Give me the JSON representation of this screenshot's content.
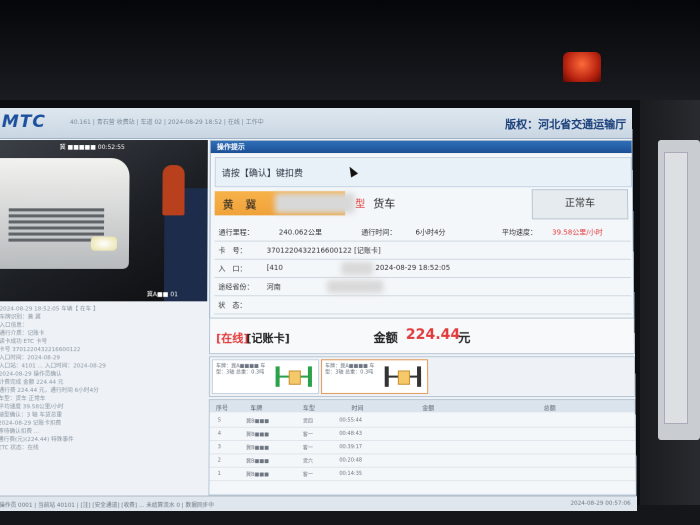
{
  "header": {
    "logo": "MTC",
    "org_name": "版权：河北省交通运输厅",
    "status_strip": "40.161  |  青石营 收费站  |  车道 02  |  2024-08-29 18:52  |  在线  |  工作中"
  },
  "camera": {
    "caption": "冀 ■■■■■  00:52:55",
    "stamp": "冀A■■ 01"
  },
  "log": [
    "2024-08-29 18:52:05 车辆【 在车 】",
    "车牌识别：黄 冀",
    "入口信息：",
    "通行介质：记账卡",
    "读卡成功 ETC 卡号",
    "卡号 3701220432216600122",
    "入口时间：2024-08-29",
    "入口站：4101 ... 入口时间：2024-08-29",
    "2024-08-29 操作员确认",
    "计费完成 金额 224.44 元",
    "通行费 224.44 元，通行时间 6小时4分",
    "车型：货车 正常车",
    "平均速度 39.58公里/小时",
    "轴型确认：3 轴 车货总重",
    "2024-08-29 记账卡扣费",
    "等待确认扣费 ...",
    "",
    "",
    "通行费(元)(224.44) 特殊事件",
    "",
    "ETC 状态：在线"
  ],
  "op_panel": {
    "title": "操作提示",
    "prompt": "请按【确认】键扣费",
    "plate_color": "黄",
    "plate_prefix": "冀",
    "plate_suffix": "型",
    "vehicle_type": "货车",
    "normal_badge": "正常车",
    "rows": {
      "mileage_label": "通行里程：",
      "mileage_value": "240.062公里",
      "time_label": "通行时间：",
      "time_value": "6小时4分",
      "speed_label": "平均速度：",
      "speed_value": "39.58公里/小时",
      "card_label": "卡　号：",
      "card_value": "3701220432216600122 [记账卡]",
      "entry_label": "入　口：",
      "entry_station": "[410",
      "entry_time": "2024-08-29 18:52:05",
      "route_label": "途经省份：",
      "route_value": "河南",
      "state_label": "状　态："
    }
  },
  "payment": {
    "status": "[在线]",
    "card_type": "[记账卡]",
    "amount_label": "金额",
    "amount_value": "224.44",
    "amount_unit": "元"
  },
  "axles": [
    {
      "text": "车牌：冀A■■■■ 车型：3轴 总重：0.3吨"
    },
    {
      "text": "车牌：冀A■■■■ 车型：3轴 总重：0.3吨"
    }
  ],
  "table": {
    "headers": [
      "序号",
      "车牌",
      "车型",
      "时间",
      "金额",
      "",
      "总额"
    ],
    "rows": [
      [
        "5",
        "冀B■■■",
        "货四",
        "00:55:44",
        "",
        "",
        ""
      ],
      [
        "4",
        "冀B■■■",
        "客一",
        "00:48:43",
        "",
        "",
        ""
      ],
      [
        "3",
        "冀B■■■",
        "客一",
        "00:39:17",
        "",
        "",
        ""
      ],
      [
        "2",
        "冀B■■■",
        "货六",
        "00:20:48",
        "",
        "",
        ""
      ],
      [
        "1",
        "冀B■■■",
        "客一",
        "00:14:35",
        "",
        "",
        ""
      ]
    ]
  },
  "bottombar": {
    "text": "操作员 0001  |  当前站 40101  |  [注]  [安全通道]  [收费]  ... 未结算流水 0  |  数据同步中",
    "time": "2024-08-29 00:57:06"
  }
}
